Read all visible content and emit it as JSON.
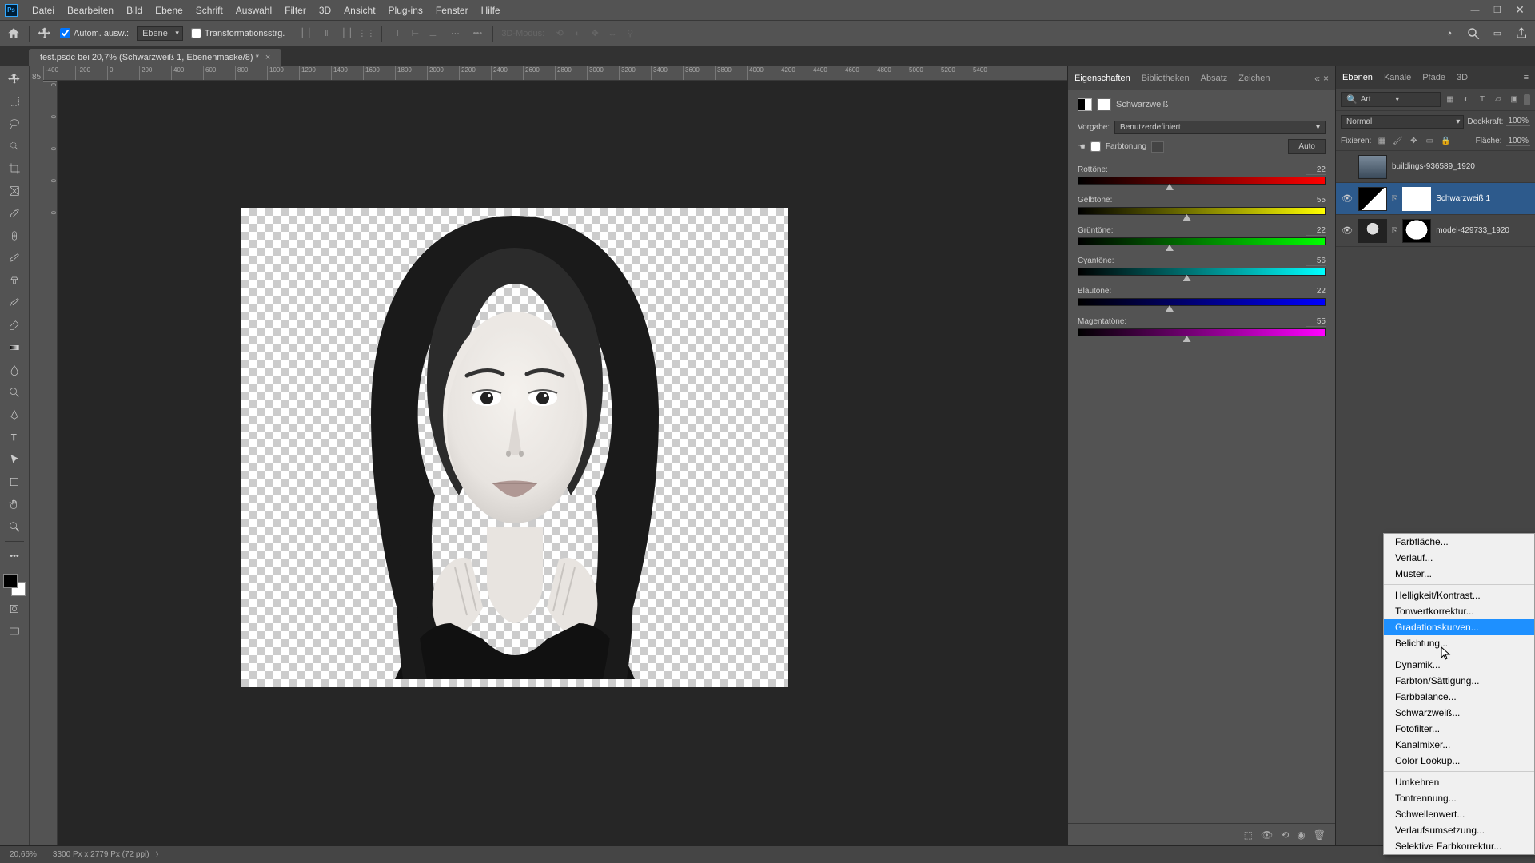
{
  "menubar": [
    "Datei",
    "Bearbeiten",
    "Bild",
    "Ebene",
    "Schrift",
    "Auswahl",
    "Filter",
    "3D",
    "Ansicht",
    "Plug-ins",
    "Fenster",
    "Hilfe"
  ],
  "optionsbar": {
    "auto_select": "Autom. ausw.:",
    "layer_dropdown": "Ebene",
    "transform_controls": "Transformationsstrg.",
    "mode3d": "3D-Modus:"
  },
  "document_tab": "test.psdc bei 20,7% (Schwarzweiß 1, Ebenenmaske/8) *",
  "ruler_h": [
    "-400",
    "-200",
    "0",
    "200",
    "400",
    "600",
    "800",
    "1000",
    "1200",
    "1400",
    "1600",
    "1800",
    "2000",
    "2200",
    "2400",
    "2600",
    "2800",
    "3000",
    "3200",
    "3400",
    "3600",
    "3800",
    "4000",
    "4200",
    "4400",
    "4600",
    "4800",
    "5000",
    "5200",
    "5400"
  ],
  "ruler_v": [
    "0",
    "0",
    "0",
    "0",
    "0"
  ],
  "properties": {
    "tabs": [
      "Eigenschaften",
      "Bibliotheken",
      "Absatz",
      "Zeichen"
    ],
    "title": "Schwarzweiß",
    "preset_label": "Vorgabe:",
    "preset_value": "Benutzerdefiniert",
    "tint_label": "Farbtonung",
    "auto_label": "Auto",
    "sliders": [
      {
        "label": "Rottöne:",
        "value": "22",
        "pos": 37,
        "grad": "grad-red"
      },
      {
        "label": "Gelbtöne:",
        "value": "55",
        "pos": 44,
        "grad": "grad-yellow"
      },
      {
        "label": "Grüntöne:",
        "value": "22",
        "pos": 37,
        "grad": "grad-green"
      },
      {
        "label": "Cyantöne:",
        "value": "56",
        "pos": 44,
        "grad": "grad-cyan"
      },
      {
        "label": "Blautöne:",
        "value": "22",
        "pos": 37,
        "grad": "grad-blue"
      },
      {
        "label": "Magentatöne:",
        "value": "55",
        "pos": 44,
        "grad": "grad-magenta"
      }
    ]
  },
  "layers_panel": {
    "tabs": [
      "Ebenen",
      "Kanäle",
      "Pfade",
      "3D"
    ],
    "search_label": "Art",
    "blend_mode": "Normal",
    "opacity_label": "Deckkraft:",
    "opacity": "100%",
    "lock_label": "Fixieren:",
    "fill_label": "Fläche:",
    "fill": "100%",
    "layers": [
      {
        "name": "buildings-936589_1920",
        "visible": false,
        "selected": false,
        "thumb": "photo"
      },
      {
        "name": "Schwarzweiß 1",
        "visible": true,
        "selected": true,
        "thumb": "adj"
      },
      {
        "name": "model-429733_1920",
        "visible": true,
        "selected": false,
        "thumb": "portrait"
      }
    ]
  },
  "context_menu": {
    "groups": [
      [
        "Farbfläche...",
        "Verlauf...",
        "Muster..."
      ],
      [
        "Helligkeit/Kontrast...",
        "Tonwertkorrektur...",
        "Gradationskurven...",
        "Belichtung..."
      ],
      [
        "Dynamik...",
        "Farbton/Sättigung...",
        "Farbbalance...",
        "Schwarzweiß...",
        "Fotofilter...",
        "Kanalmixer...",
        "Color Lookup..."
      ],
      [
        "Umkehren",
        "Tontrennung...",
        "Schwellenwert...",
        "Verlaufsumsetzung...",
        "Selektive Farbkorrektur..."
      ]
    ],
    "highlighted": "Gradationskurven..."
  },
  "statusbar": {
    "zoom": "20,66%",
    "doc_info": "3300 Px x 2779 Px (72 ppi)"
  }
}
